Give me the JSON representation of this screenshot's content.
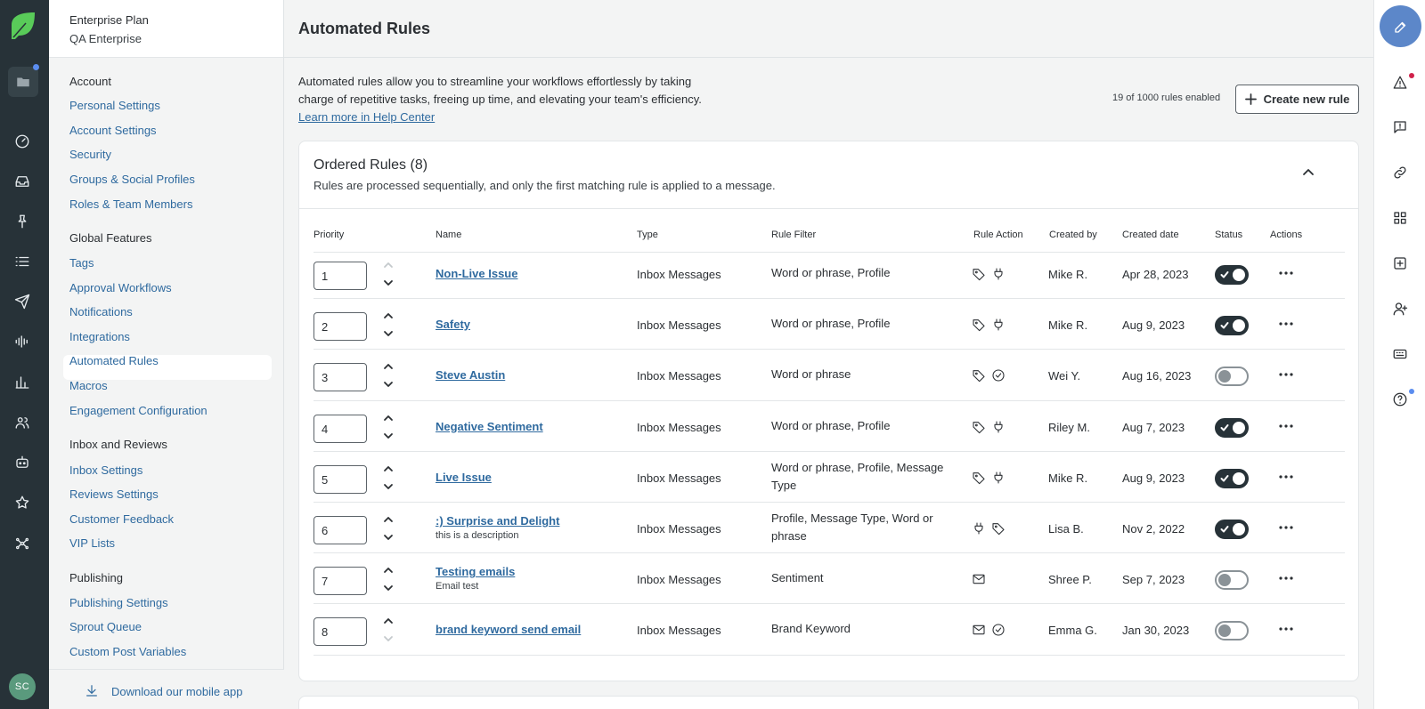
{
  "sidebar": {
    "plan_name": "Enterprise Plan",
    "account_name": "QA Enterprise",
    "sections": [
      {
        "title": "Account",
        "items": [
          "Personal Settings",
          "Account Settings",
          "Security",
          "Groups & Social Profiles",
          "Roles & Team Members"
        ]
      },
      {
        "title": "Global Features",
        "items": [
          "Tags",
          "Approval Workflows",
          "Notifications",
          "Integrations",
          "Automated Rules",
          "Macros",
          "Engagement Configuration"
        ]
      },
      {
        "title": "Inbox and Reviews",
        "items": [
          "Inbox Settings",
          "Reviews Settings",
          "Customer Feedback",
          "VIP Lists"
        ]
      },
      {
        "title": "Publishing",
        "items": [
          "Publishing Settings",
          "Sprout Queue",
          "Custom Post Variables"
        ]
      }
    ],
    "active_item": "Automated Rules",
    "download_label": "Download our mobile app"
  },
  "rail": {
    "avatar_initials": "SC"
  },
  "page": {
    "title": "Automated Rules",
    "intro": "Automated rules allow you to streamline your workflows effortlessly by taking charge of repetitive tasks, freeing up time, and elevating your team's efficiency.",
    "help_link": "Learn more in Help Center",
    "rules_count": "19 of 1000 rules enabled",
    "create_button": "Create new rule"
  },
  "ordered_rules": {
    "title": "Ordered Rules (8)",
    "subtitle": "Rules are processed sequentially, and only the first matching rule is applied to a message.",
    "columns": [
      "Priority",
      "Name",
      "Type",
      "Rule Filter",
      "Rule Action",
      "Created by",
      "Created date",
      "Status",
      "Actions"
    ],
    "rows": [
      {
        "priority": "1",
        "name": "Non-Live Issue",
        "description": "",
        "type": "Inbox Messages",
        "filter": "Word or phrase, Profile",
        "actions": [
          "tag-icon",
          "plug-icon"
        ],
        "created_by": "Mike R.",
        "created_date": "Apr 28, 2023",
        "enabled": true
      },
      {
        "priority": "2",
        "name": "Safety",
        "description": "",
        "type": "Inbox Messages",
        "filter": "Word or phrase, Profile",
        "actions": [
          "tag-icon",
          "plug-icon"
        ],
        "created_by": "Mike R.",
        "created_date": "Aug 9, 2023",
        "enabled": true
      },
      {
        "priority": "3",
        "name": "Steve Austin",
        "description": "",
        "type": "Inbox Messages",
        "filter": "Word or phrase",
        "actions": [
          "tag-icon",
          "check-circle-icon"
        ],
        "created_by": "Wei Y.",
        "created_date": "Aug 16, 2023",
        "enabled": false
      },
      {
        "priority": "4",
        "name": "Negative Sentiment",
        "description": "",
        "type": "Inbox Messages",
        "filter": "Word or phrase, Profile",
        "actions": [
          "tag-icon",
          "plug-icon"
        ],
        "created_by": "Riley M.",
        "created_date": "Aug 7, 2023",
        "enabled": true
      },
      {
        "priority": "5",
        "name": "Live Issue",
        "description": "",
        "type": "Inbox Messages",
        "filter": "Word or phrase, Profile, Message Type",
        "actions": [
          "tag-icon",
          "plug-icon"
        ],
        "created_by": "Mike R.",
        "created_date": "Aug 9, 2023",
        "enabled": true
      },
      {
        "priority": "6",
        "name": ":) Surprise and Delight",
        "description": "this is a description",
        "type": "Inbox Messages",
        "filter": "Profile, Message Type, Word or phrase",
        "actions": [
          "plug-icon",
          "tag-icon"
        ],
        "created_by": "Lisa B.",
        "created_date": "Nov 2, 2022",
        "enabled": true
      },
      {
        "priority": "7",
        "name": "Testing emails",
        "description": "Email test",
        "type": "Inbox Messages",
        "filter": "Sentiment",
        "actions": [
          "mail-icon"
        ],
        "created_by": "Shree P.",
        "created_date": "Sep 7, 2023",
        "enabled": false
      },
      {
        "priority": "8",
        "name": "brand keyword send email",
        "description": "",
        "type": "Inbox Messages",
        "filter": "Brand Keyword",
        "actions": [
          "mail-icon",
          "check-circle-icon"
        ],
        "created_by": "Emma G.",
        "created_date": "Jan 30, 2023",
        "enabled": false
      }
    ]
  },
  "colors": {
    "link": "#2f6a9f",
    "rail_bg": "#273238",
    "toggle_on": "#273238",
    "compose_bg": "#5c87c9",
    "notification_red": "#d0214a",
    "notification_blue": "#5b8def"
  }
}
